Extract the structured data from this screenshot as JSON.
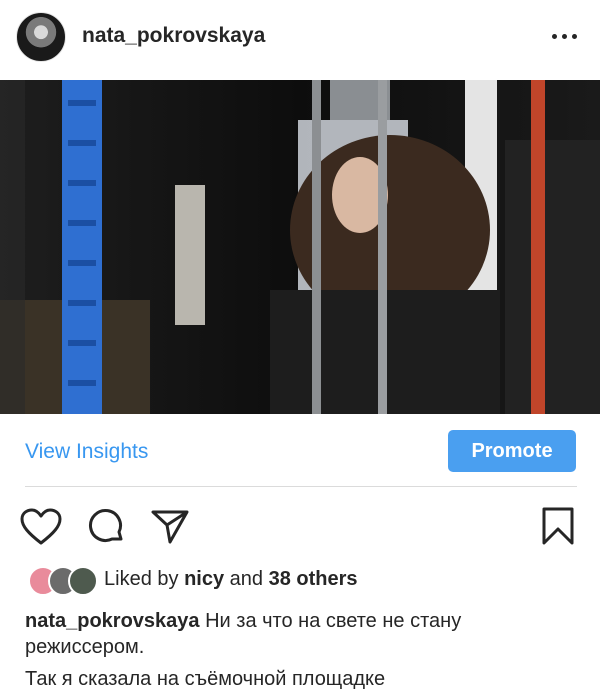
{
  "post": {
    "username": "nata_pokrovskaya",
    "avatar_icon": "profile-avatar",
    "more_icon": "more-options-icon"
  },
  "photo": {
    "icon": "post-photo"
  },
  "insights": {
    "view_label": "View Insights",
    "promote_label": "Promote",
    "accent": "#3897f0"
  },
  "actions": {
    "like_icon": "heart-icon",
    "comment_icon": "comment-icon",
    "share_icon": "share-icon",
    "save_icon": "bookmark-icon"
  },
  "likes": {
    "prefix": "Liked by",
    "first_user": "nicy",
    "connector": "and",
    "others": "38 others"
  },
  "caption": {
    "username": "nata_pokrovskaya",
    "line1": "Ни за что на свете не стану режиссером.",
    "line2": "Так я сказала на съёмочной площадке"
  }
}
